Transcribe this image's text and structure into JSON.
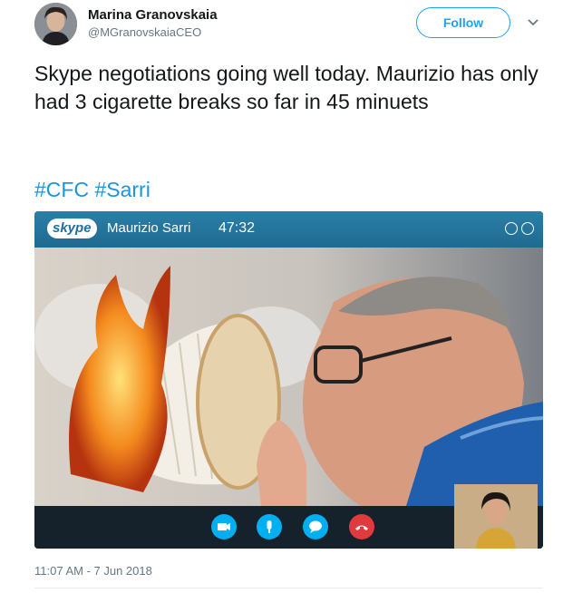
{
  "author": {
    "name": "Marina Granovskaia",
    "handle": "@MGranovskaiaCEO"
  },
  "follow_label": "Follow",
  "tweet": {
    "text": "Skype negotiations going well today. Maurizio has only had 3 cigarette breaks so far in 45 minuets",
    "hashtags": [
      "#CFC",
      "#Sarri"
    ]
  },
  "media": {
    "app_logo": "skype",
    "caller_name": "Maurizio Sarri",
    "call_timer": "47:32",
    "controls": [
      "video-icon",
      "mic-icon",
      "chat-icon",
      "hangup-icon"
    ]
  },
  "timestamp": "11:07 AM - 7 Jun 2018",
  "colors": {
    "brand_blue": "#1da1f2",
    "hashtag_blue": "#1b95e0",
    "skype_bar": "#2a7fa8",
    "hangup_red": "#e0393e"
  }
}
